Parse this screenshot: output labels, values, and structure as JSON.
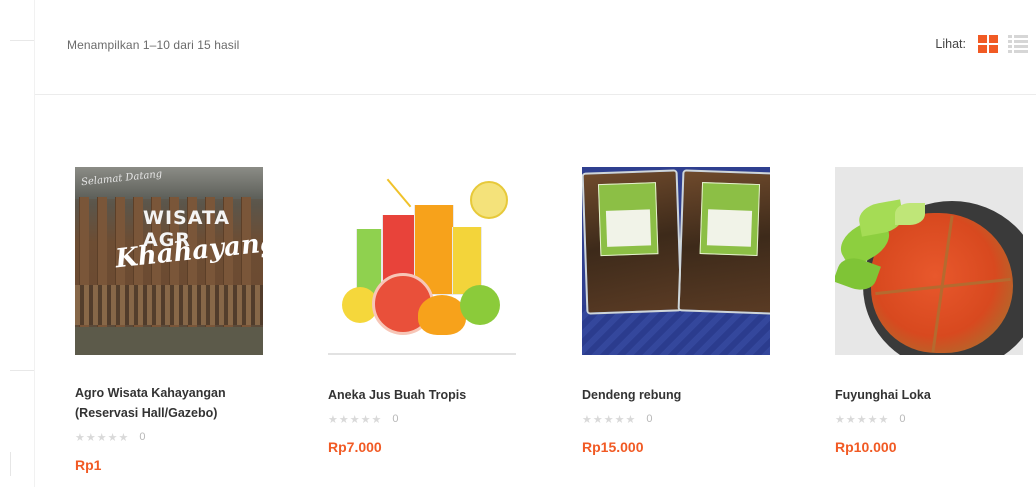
{
  "toolbar": {
    "result_count": "Menampilkan 1–10 dari 15 hasil",
    "view_label": "Lihat:",
    "view_modes": [
      {
        "icon": "grid-view-icon",
        "active": true
      },
      {
        "icon": "list-view-icon",
        "active": false
      }
    ]
  },
  "colors": {
    "accent": "#f15a24",
    "star_empty": "#d9d9d9",
    "text": "#333333"
  },
  "products": [
    {
      "title_line1": "Agro Wisata Kahayangan",
      "title_line2": "(Reservasi Hall/Gazebo)",
      "image_text_top": "Selamat Datang",
      "image_text_main": "WISATA AGR",
      "image_text_script": "Khahayanga",
      "rating_stars": "★★★★★",
      "rating_count": "0",
      "price": "Rp1"
    },
    {
      "title_line1": "Aneka Jus Buah Tropis",
      "title_line2": "",
      "rating_stars": "★★★★★",
      "rating_count": "0",
      "price": "Rp7.000"
    },
    {
      "title_line1": "Dendeng rebung",
      "title_line2": "",
      "rating_stars": "★★★★★",
      "rating_count": "0",
      "price": "Rp15.000"
    },
    {
      "title_line1": "Fuyunghai Loka",
      "title_line2": "",
      "rating_stars": "★★★★★",
      "rating_count": "0",
      "price": "Rp10.000"
    }
  ]
}
